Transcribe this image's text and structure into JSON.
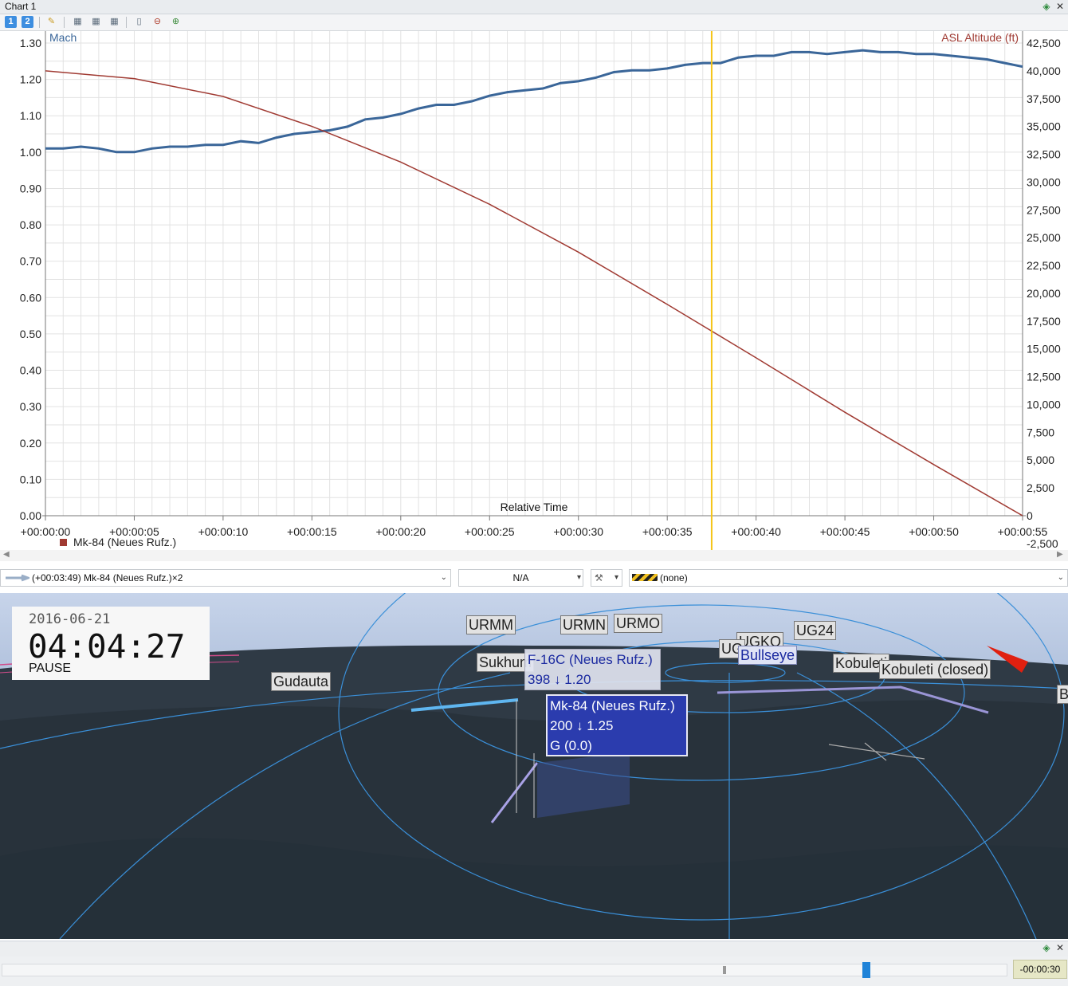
{
  "window": {
    "title": "Chart 1",
    "pin_icon": "pin-icon",
    "close_icon": "close-icon"
  },
  "toolbar": {
    "btn1": "1",
    "btn2": "2"
  },
  "chart_data": {
    "type": "line",
    "xlabel": "Relative Time",
    "ylabel_left": "Mach",
    "ylabel_right": "ASL Altitude (ft)",
    "xlim": [
      0,
      55
    ],
    "ylim_left": [
      0,
      1.3
    ],
    "ylim_right": [
      0,
      42500
    ],
    "x_ticks": [
      "+00:00:00",
      "+00:00:05",
      "+00:00:10",
      "+00:00:15",
      "+00:00:20",
      "+00:00:25",
      "+00:00:30",
      "+00:00:35",
      "+00:00:40",
      "+00:00:45",
      "+00:00:50",
      "+00:00:55"
    ],
    "y_left_ticks": [
      "0.00",
      "0.10",
      "0.20",
      "0.30",
      "0.40",
      "0.50",
      "0.60",
      "0.70",
      "0.80",
      "0.90",
      "1.00",
      "1.10",
      "1.20",
      "1.30"
    ],
    "y_right_ticks": [
      "-2,500",
      "0",
      "2,500",
      "5,000",
      "7,500",
      "10,000",
      "12,500",
      "15,000",
      "17,500",
      "20,000",
      "22,500",
      "25,000",
      "27,500",
      "30,000",
      "32,500",
      "35,000",
      "37,500",
      "40,000",
      "42,500"
    ],
    "cursor_x": 37.5,
    "legend": "Mk-84 (Neues Rufz.)",
    "colors": {
      "mach": "#3a6699",
      "altitude": "#a03a32",
      "cursor": "#f5c518",
      "grid": "#e2e2e2"
    },
    "series": [
      {
        "name": "Mach",
        "axis": "left",
        "x": [
          0,
          1,
          2,
          3,
          4,
          5,
          6,
          7,
          8,
          9,
          10,
          11,
          12,
          13,
          14,
          15,
          16,
          17,
          18,
          19,
          20,
          21,
          22,
          23,
          24,
          25,
          26,
          27,
          28,
          29,
          30,
          31,
          32,
          33,
          34,
          35,
          36,
          37,
          38,
          39,
          40,
          41,
          42,
          43,
          44,
          45,
          46,
          47,
          48,
          49,
          50,
          51,
          52,
          53,
          54,
          55
        ],
        "y": [
          1.01,
          1.01,
          1.015,
          1.01,
          1.0,
          1.0,
          1.01,
          1.015,
          1.015,
          1.02,
          1.02,
          1.03,
          1.025,
          1.04,
          1.05,
          1.055,
          1.06,
          1.07,
          1.09,
          1.095,
          1.105,
          1.12,
          1.13,
          1.13,
          1.14,
          1.155,
          1.165,
          1.17,
          1.175,
          1.19,
          1.195,
          1.205,
          1.22,
          1.225,
          1.225,
          1.23,
          1.24,
          1.245,
          1.245,
          1.26,
          1.265,
          1.265,
          1.275,
          1.275,
          1.27,
          1.275,
          1.28,
          1.275,
          1.275,
          1.27,
          1.27,
          1.265,
          1.26,
          1.255,
          1.245,
          1.235
        ]
      },
      {
        "name": "ASL Altitude (ft)",
        "axis": "right",
        "x": [
          0,
          5,
          10,
          15,
          20,
          25,
          30,
          35,
          40,
          45,
          50,
          55
        ],
        "y": [
          40000,
          39300,
          37700,
          35000,
          31800,
          28000,
          23700,
          19000,
          14200,
          9300,
          4600,
          0
        ]
      }
    ]
  },
  "selector": {
    "object": "(+00:03:49) Mk-84 (Neues Rufz.)×2",
    "value": "N/A",
    "filter": "(none)"
  },
  "view": {
    "date": "2016-06-21",
    "time": "04:04:27",
    "state": "PAUSE",
    "labels": {
      "urmm": "URMM",
      "urmn": "URMN",
      "urmo": "URMO",
      "ugko": "UGKO",
      "ug24": "UG24",
      "ug": "UG",
      "sukhumi": "Sukhum",
      "gudauta": "Gudauta",
      "bullseye": "Bullseye",
      "kobuleti": "Kobuleti",
      "kobuleti_closed": "Kobuleti (closed)",
      "b": "B"
    },
    "f16": {
      "name": "F-16C (Neues Rufz.)",
      "stats": "398 ↓ 1.20"
    },
    "mk84": {
      "name": "Mk-84 (Neues Rufz.)",
      "stats": "200 ↓ 1.25",
      "g": "G (0.0)"
    }
  },
  "timeline": {
    "offset": "-00:00:30",
    "progress": 0.86
  }
}
